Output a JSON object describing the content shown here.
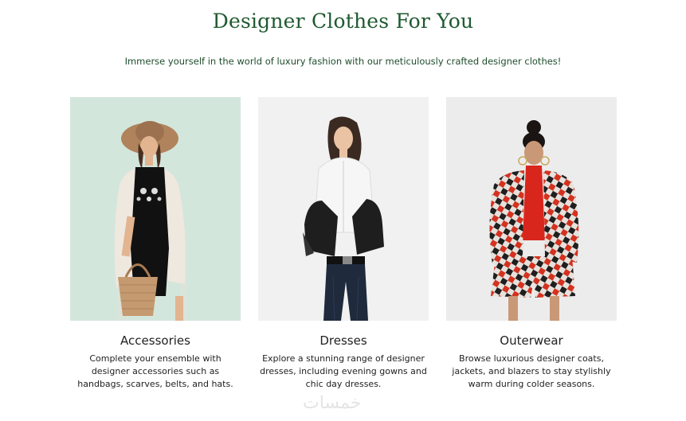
{
  "header": {
    "title": "Designer Clothes For You",
    "subtitle": "Immerse yourself in the world of luxury fashion with our meticulously crafted designer clothes!"
  },
  "cards": [
    {
      "title": "Accessories",
      "description": "Complete your ensemble with designer accessories such as handbags, scarves, belts, and hats."
    },
    {
      "title": "Dresses",
      "description": "Explore a stunning range of designer dresses, including evening gowns and chic day dresses."
    },
    {
      "title": "Outerwear",
      "description": "Browse luxurious designer coats, jackets, and blazers to stay stylishly warm during colder seasons."
    }
  ],
  "watermark": "خمسات",
  "colors": {
    "title": "#1f5a30",
    "card1_bg": "#d3e6dc",
    "card2_bg": "#f1f1f1",
    "card3_bg": "#ececec"
  }
}
